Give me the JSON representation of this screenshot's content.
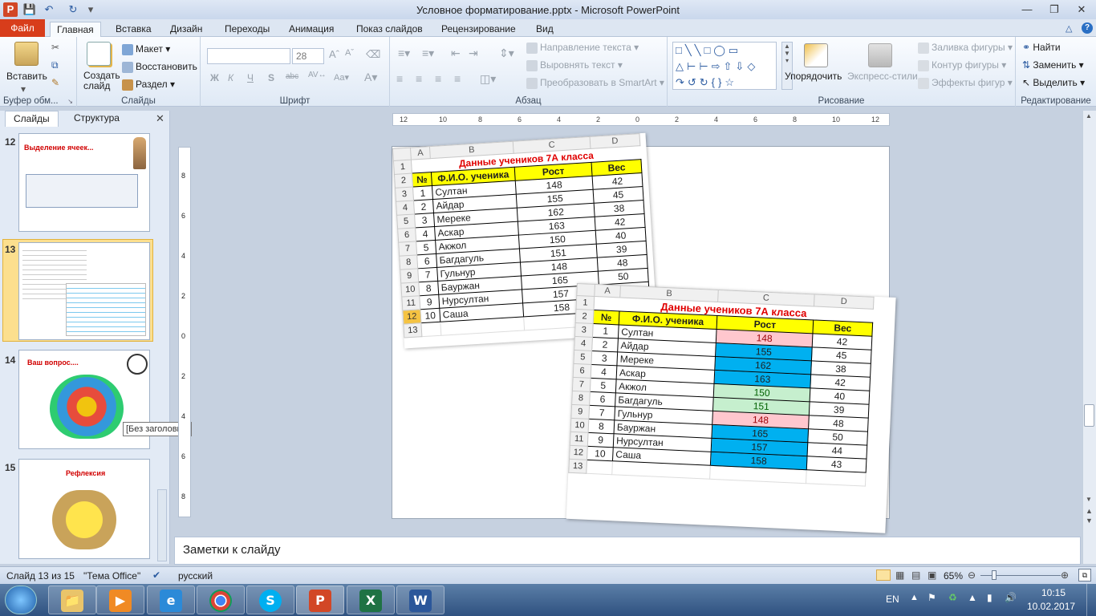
{
  "window": {
    "title": "Условное форматирование.pptx - Microsoft PowerPoint"
  },
  "tabs": [
    "Файл",
    "Главная",
    "Вставка",
    "Дизайн",
    "Переходы",
    "Анимация",
    "Показ слайдов",
    "Рецензирование",
    "Вид"
  ],
  "ribbon": {
    "clipboard": {
      "label": "Буфер обм...",
      "paste": "Вставить"
    },
    "slides": {
      "label": "Слайды",
      "new_slide": "Создать слайд",
      "layout": "Макет",
      "reset": "Восстановить",
      "section": "Раздел"
    },
    "font": {
      "label": "Шрифт",
      "font_name": "",
      "font_size": "28"
    },
    "paragraph": {
      "label": "Абзац",
      "text_direction": "Направление текста",
      "align_text": "Выровнять текст",
      "smartart": "Преобразовать в SmartArt"
    },
    "drawing": {
      "label": "Рисование",
      "arrange": "Упорядочить",
      "quick_styles": "Экспресс-стили",
      "fill": "Заливка фигуры",
      "outline": "Контур фигуры",
      "effects": "Эффекты фигур"
    },
    "editing": {
      "label": "Редактирование",
      "find": "Найти",
      "replace": "Заменить",
      "select": "Выделить"
    }
  },
  "left_pane": {
    "tabs": [
      "Слайды",
      "Структура"
    ],
    "slides": [
      {
        "num": "12",
        "title": "Выделение ячеек..."
      },
      {
        "num": "13",
        "title": ""
      },
      {
        "num": "14",
        "title": "Ваш вопрос...."
      },
      {
        "num": "15",
        "title": "Рефлексия"
      }
    ],
    "tooltip": "[Без заголовка]"
  },
  "ruler": {
    "h_ticks": [
      "12",
      "10",
      "8",
      "6",
      "4",
      "2",
      "0",
      "2",
      "4",
      "6",
      "8",
      "10",
      "12"
    ],
    "v_ticks": [
      "8",
      "6",
      "4",
      "2",
      "0",
      "2",
      "4",
      "6",
      "8"
    ]
  },
  "table_title": "Данные  учеников 7А класса",
  "table_headers": [
    "№",
    "Ф.И.О. ученика",
    "Рост",
    "Вес"
  ],
  "col_letters": [
    "A",
    "B",
    "C",
    "D"
  ],
  "students": [
    {
      "n": "1",
      "name": "Султан",
      "h": "148",
      "w": "42",
      "fill": "#ffc7ce",
      "fc": "#9c0006"
    },
    {
      "n": "2",
      "name": "Айдар",
      "h": "155",
      "w": "45",
      "fill": "#00b0f0",
      "fc": "#1e1e1e"
    },
    {
      "n": "3",
      "name": "Мереке",
      "h": "162",
      "w": "38",
      "fill": "#00b0f0",
      "fc": "#1e1e1e"
    },
    {
      "n": "4",
      "name": "Аскар",
      "h": "163",
      "w": "42",
      "fill": "#00b0f0",
      "fc": "#1e1e1e"
    },
    {
      "n": "5",
      "name": "Акжол",
      "h": "150",
      "w": "40",
      "fill": "#c6efce",
      "fc": "#006100"
    },
    {
      "n": "6",
      "name": "Багдагуль",
      "h": "151",
      "w": "39",
      "fill": "#c6efce",
      "fc": "#006100"
    },
    {
      "n": "7",
      "name": "Гульнур",
      "h": "148",
      "w": "48",
      "fill": "#ffc7ce",
      "fc": "#9c0006"
    },
    {
      "n": "8",
      "name": "Бауржан",
      "h": "165",
      "w": "50",
      "fill": "#00b0f0",
      "fc": "#1e1e1e"
    },
    {
      "n": "9",
      "name": "Нурсултан",
      "h": "157",
      "w": "44",
      "fill": "#00b0f0",
      "fc": "#1e1e1e"
    },
    {
      "n": "10",
      "name": "Саша",
      "h": "158",
      "w": "43",
      "fill": "#00b0f0",
      "fc": "#1e1e1e"
    }
  ],
  "notes_placeholder": "Заметки  к слайду",
  "status": {
    "slide_info": "Слайд 13 из 15",
    "theme": "\"Тема Office\"",
    "language": "русский",
    "zoom": "65%"
  },
  "tray": {
    "lang": "EN",
    "time": "10:15",
    "date": "10.02.2017"
  },
  "taskbar_apps": [
    "Проводник",
    "Windows Media Player",
    "Internet Explorer",
    "Google Chrome",
    "Skype",
    "PowerPoint",
    "Excel",
    "Word"
  ]
}
